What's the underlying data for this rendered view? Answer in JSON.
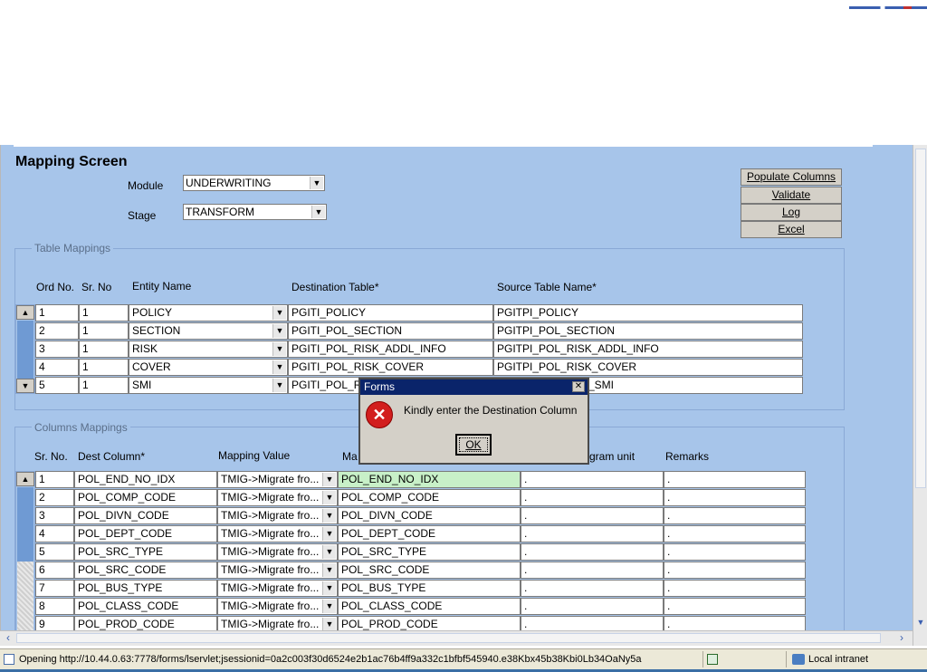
{
  "page": {
    "title": "Mapping Screen",
    "module_label": "Module",
    "module_value": "UNDERWRITING",
    "stage_label": "Stage",
    "stage_value": "TRANSFORM"
  },
  "actions": {
    "populate": "Populate Columns",
    "validate": "Validate",
    "log": "Log",
    "excel": "Excel"
  },
  "table_mappings": {
    "title": "Table Mappings",
    "headers": [
      "Ord No.",
      "Sr. No",
      "Entity Name",
      "Destination Table*",
      "Source Table Name*"
    ],
    "rows": [
      {
        "ord": "1",
        "sr": "1",
        "entity": "POLICY",
        "dest": "PGITI_POLICY",
        "source": "PGITPI_POLICY"
      },
      {
        "ord": "2",
        "sr": "1",
        "entity": "SECTION",
        "dest": "PGITI_POL_SECTION",
        "source": "PGITPI_POL_SECTION"
      },
      {
        "ord": "3",
        "sr": "1",
        "entity": "RISK",
        "dest": "PGITI_POL_RISK_ADDL_INFO",
        "source": "PGITPI_POL_RISK_ADDL_INFO"
      },
      {
        "ord": "4",
        "sr": "1",
        "entity": "COVER",
        "dest": "PGITI_POL_RISK_COVER",
        "source": "PGITPI_POL_RISK_COVER"
      },
      {
        "ord": "5",
        "sr": "1",
        "entity": "SMI",
        "dest": "PGITI_POL_R",
        "source": "_SMI"
      }
    ]
  },
  "column_mappings": {
    "title": "Columns Mappings",
    "headers": [
      "Sr. No.",
      "Dest Column*",
      "Mapping Value",
      "Ma",
      "gram unit",
      "Remarks"
    ],
    "rows": [
      {
        "sr": "1",
        "dest": "POL_END_NO_IDX",
        "mapping": "TMIG->Migrate fro...",
        "map_col": "POL_END_NO_IDX",
        "prog": ".",
        "rem": "."
      },
      {
        "sr": "2",
        "dest": "POL_COMP_CODE",
        "mapping": "TMIG->Migrate fro...",
        "map_col": "POL_COMP_CODE",
        "prog": ".",
        "rem": "."
      },
      {
        "sr": "3",
        "dest": "POL_DIVN_CODE",
        "mapping": "TMIG->Migrate fro...",
        "map_col": "POL_DIVN_CODE",
        "prog": ".",
        "rem": "."
      },
      {
        "sr": "4",
        "dest": "POL_DEPT_CODE",
        "mapping": "TMIG->Migrate fro...",
        "map_col": "POL_DEPT_CODE",
        "prog": ".",
        "rem": "."
      },
      {
        "sr": "5",
        "dest": "POL_SRC_TYPE",
        "mapping": "TMIG->Migrate fro...",
        "map_col": "POL_SRC_TYPE",
        "prog": ".",
        "rem": "."
      },
      {
        "sr": "6",
        "dest": "POL_SRC_CODE",
        "mapping": "TMIG->Migrate fro...",
        "map_col": "POL_SRC_CODE",
        "prog": ".",
        "rem": "."
      },
      {
        "sr": "7",
        "dest": "POL_BUS_TYPE",
        "mapping": "TMIG->Migrate fro...",
        "map_col": "POL_BUS_TYPE",
        "prog": ".",
        "rem": "."
      },
      {
        "sr": "8",
        "dest": "POL_CLASS_CODE",
        "mapping": "TMIG->Migrate fro...",
        "map_col": "POL_CLASS_CODE",
        "prog": ".",
        "rem": "."
      },
      {
        "sr": "9",
        "dest": "POL_PROD_CODE",
        "mapping": "TMIG->Migrate fro...",
        "map_col": "POL_PROD_CODE",
        "prog": ".",
        "rem": "."
      }
    ]
  },
  "dialog": {
    "title": "Forms",
    "message": "Kindly enter the Destination Column",
    "ok": "OK"
  },
  "status": {
    "text": "Opening http://10.44.0.63:7778/forms/lservlet;jsessionid=0a2c003f30d6524e2b1ac76b4ff9a332c1bfbf545940.e38Kbx45b38Kbi0Lb34OaNy5a",
    "zone": "Local intranet"
  },
  "colors": {
    "form_bg": "#a7c5ea",
    "titlebar": "#0a246a",
    "highlight_cell": "#c8f0c8",
    "error_red": "#d21e1e"
  },
  "icons": [
    "ie-page-icon",
    "error-icon",
    "close-icon",
    "chevron-down-icon",
    "chevron-up-icon",
    "local-intranet-icon",
    "popup-blocker-icon"
  ]
}
